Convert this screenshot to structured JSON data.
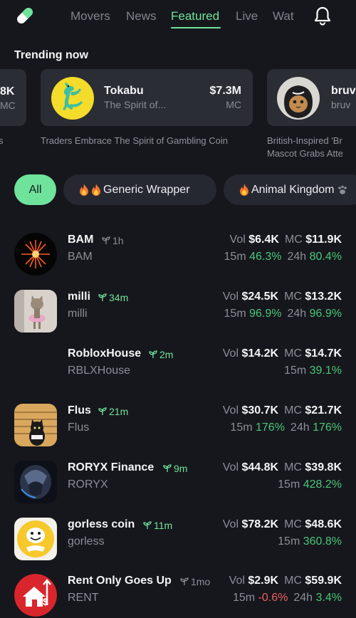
{
  "nav": {
    "tabs": [
      "Movers",
      "News",
      "Featured",
      "Live",
      "Wat"
    ],
    "active_tab": "Featured"
  },
  "trending": {
    "title": "Trending now",
    "left_partial": {
      "value": "8K",
      "unit": "MC",
      "headline": "s"
    },
    "main": {
      "name": "Tokabu",
      "subtitle": "The Spirit of...",
      "value": "$7.3M",
      "unit": "MC",
      "headline": "Traders Embrace The Spirit of Gambling Coin"
    },
    "right_partial": {
      "name": "bruv",
      "subtitle": "bruv",
      "headline_1": "British-Inspired 'Br",
      "headline_2": "Mascot Grabs Atte"
    }
  },
  "filters": {
    "all": "All",
    "chip1": "Generic Wrapper",
    "chip2": "Animal Kingdom"
  },
  "tokens": [
    {
      "name": "BAM",
      "age": "1h",
      "ticker": "BAM",
      "vol_label": "Vol",
      "vol": "$6.4K",
      "mc_label": "MC",
      "mc": "$11.9K",
      "c15_label": "15m",
      "c15": "46.3%",
      "c24_label": "24h",
      "c24": "80.4%"
    },
    {
      "name": "milli",
      "age": "34m",
      "ticker": "milli",
      "vol_label": "Vol",
      "vol": "$24.5K",
      "mc_label": "MC",
      "mc": "$13.2K",
      "c15_label": "15m",
      "c15": "96.9%",
      "c24_label": "24h",
      "c24": "96.9%"
    },
    {
      "name": "RobloxHouse",
      "age": "2m",
      "ticker": "RBLXHouse",
      "vol_label": "Vol",
      "vol": "$14.2K",
      "mc_label": "MC",
      "mc": "$14.7K",
      "c15_label": "15m",
      "c15": "39.1%"
    },
    {
      "name": "Flus",
      "age": "21m",
      "ticker": "Flus",
      "vol_label": "Vol",
      "vol": "$30.7K",
      "mc_label": "MC",
      "mc": "$21.7K",
      "c15_label": "15m",
      "c15": "176%",
      "c24_label": "24h",
      "c24": "176%"
    },
    {
      "name": "RORYX Finance",
      "age": "9m",
      "ticker": "RORYX",
      "vol_label": "Vol",
      "vol": "$44.8K",
      "mc_label": "MC",
      "mc": "$39.8K",
      "c15_label": "15m",
      "c15": "428.2%"
    },
    {
      "name": "gorless coin",
      "age": "11m",
      "ticker": "gorless",
      "vol_label": "Vol",
      "vol": "$78.2K",
      "mc_label": "MC",
      "mc": "$48.6K",
      "c15_label": "15m",
      "c15": "360.8%"
    },
    {
      "name": "Rent Only Goes Up",
      "age": "1mo",
      "ticker": "RENT",
      "vol_label": "Vol",
      "vol": "$2.9K",
      "mc_label": "MC",
      "mc": "$59.9K",
      "c15_label": "15m",
      "c15": "-0.6%",
      "c24_label": "24h",
      "c24": "3.4%"
    }
  ],
  "colors": {
    "accent": "#6fe39b",
    "positive": "#49c77a",
    "negative": "#ef5f5f",
    "background": "#16171c",
    "card": "#2b2d34"
  }
}
